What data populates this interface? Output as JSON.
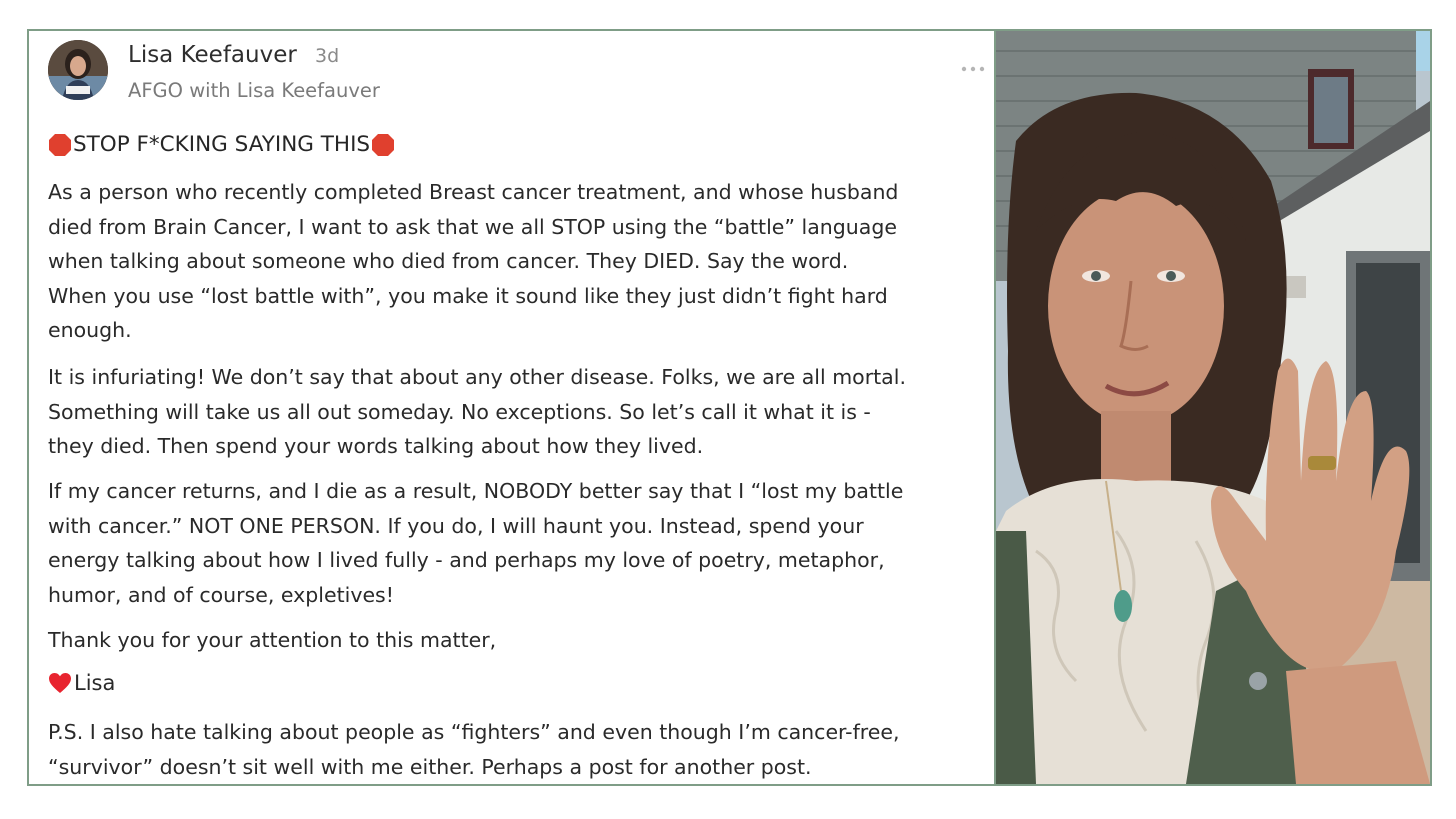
{
  "post": {
    "author": "Lisa Keefauver",
    "timestamp": "3d",
    "group": "AFGO with Lisa Keefauver",
    "more_menu_icon": "ellipsis-icon",
    "headline": "STOP F*CKING SAYING THIS",
    "headline_icon": "stop-sign-icon",
    "paragraphs": [
      [
        "As a person who recently completed Breast cancer treatment, and whose husband",
        "died from Brain Cancer, I want to ask that we all STOP using the “battle” language",
        "when talking about someone who died from cancer. They DIED. Say the word.",
        "When you use “lost battle with”, you make it sound like they just didn’t fight hard",
        "enough."
      ],
      [
        "It is infuriating! We don’t say that about any other disease. Folks, we are all mortal.",
        "Something will take us all out someday. No exceptions. So let’s call it what it is -",
        "they died. Then spend your words talking about how they lived."
      ],
      [
        "If my cancer returns, and I die as a result, NOBODY better say that I “lost my battle",
        "with cancer.” NOT ONE PERSON. If you do, I will haunt you. Instead, spend your",
        "energy talking about how I lived fully - and perhaps my love of poetry, metaphor,",
        "humor, and of course, expletives!"
      ],
      [
        "Thank you for your attention to this matter,"
      ]
    ],
    "signoff": "Lisa",
    "signoff_icon": "heart-icon",
    "postscript": [
      "P.S. I also hate talking about people as “fighters” and even though I’m cancer-free,",
      "“survivor” doesn’t sit well with me either. Perhaps a post for another post."
    ]
  },
  "colors": {
    "border": "#7f9d87",
    "text": "#2a2a2a",
    "muted": "#7a7a7a",
    "stop_red": "#e0402e",
    "heart_red": "#e8242f"
  }
}
